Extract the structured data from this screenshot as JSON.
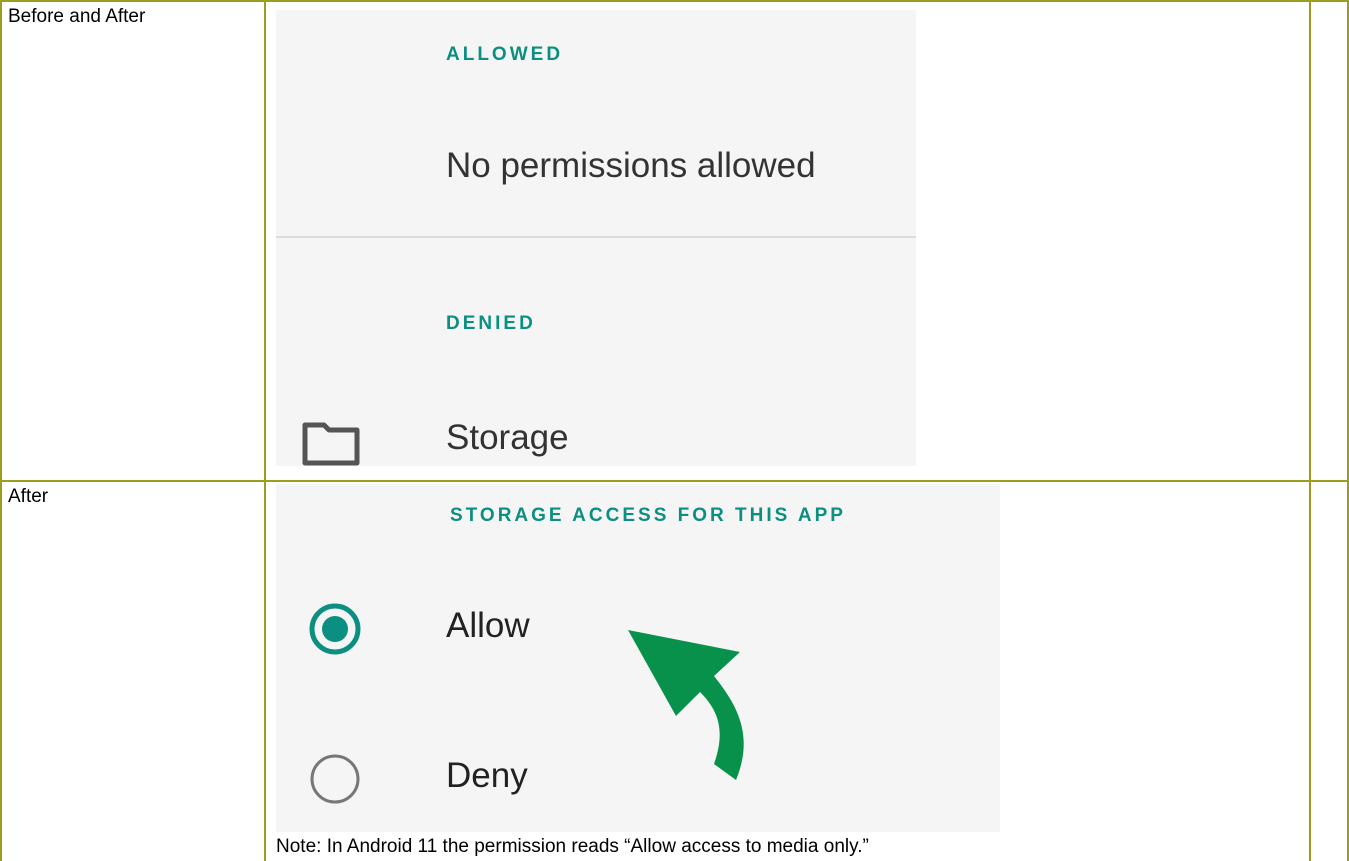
{
  "rows": [
    {
      "label": "Before and After",
      "screenshot": {
        "allowed_header": "ALLOWED",
        "allowed_empty": "No permissions allowed",
        "denied_header": "DENIED",
        "denied_items": [
          {
            "icon": "folder-icon",
            "label": "Storage"
          }
        ]
      }
    },
    {
      "label": "After",
      "screenshot": {
        "header": "STORAGE ACCESS FOR THIS APP",
        "options": [
          {
            "label": "Allow",
            "selected": true
          },
          {
            "label": "Deny",
            "selected": false
          }
        ],
        "annotation": "green-arrow-icon"
      },
      "note": "Note: In Android 11 the permission reads “Allow access to media only.”"
    }
  ],
  "colors": {
    "border": "#9c9c1e",
    "accent": "#0a8f80",
    "arrow": "#07914b"
  }
}
